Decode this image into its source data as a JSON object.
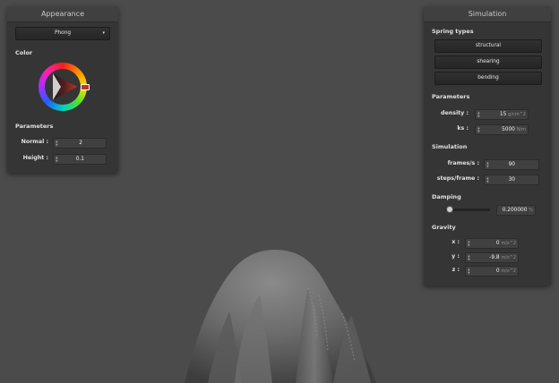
{
  "appearance": {
    "title": "Appearance",
    "shader_select": "Phong",
    "color_label": "Color",
    "params_label": "Parameters",
    "normal_label": "Normal :",
    "normal_value": "2",
    "height_label": "Height :",
    "height_value": "0.1",
    "selected_color": "#c0352a"
  },
  "simulation": {
    "title": "Simulation",
    "spring_types_label": "Spring types",
    "spring_buttons": [
      "structural",
      "shearing",
      "bending"
    ],
    "params_label": "Parameters",
    "density_label": "density :",
    "density_value": "15",
    "density_unit": "g/cm^2",
    "ks_label": "ks :",
    "ks_value": "5000",
    "ks_unit": "N/m",
    "sim_label": "Simulation",
    "fps_label": "frames/s :",
    "fps_value": "90",
    "steps_label": "steps/frame :",
    "steps_value": "30",
    "damping_label": "Damping",
    "damping_value": "0.200000",
    "damping_unit": "%",
    "damping_level": 0.02,
    "gravity_label": "Gravity",
    "gx_label": "x :",
    "gx_value": "0",
    "gy_label": "y :",
    "gy_value": "-9.8",
    "gz_label": "z :",
    "gz_value": "0",
    "gravity_unit": "m/s^2"
  }
}
